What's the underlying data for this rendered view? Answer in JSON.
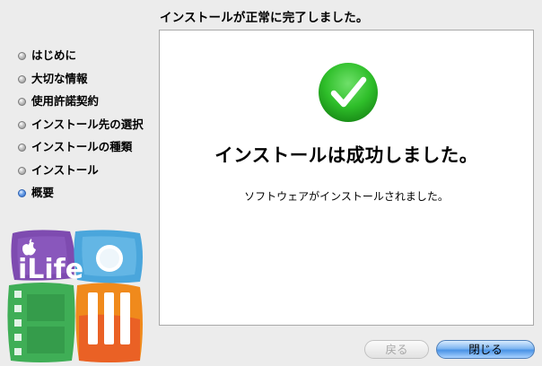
{
  "header": {
    "title": "インストールが正常に完了しました。"
  },
  "sidebar": {
    "steps": [
      {
        "label": "はじめに",
        "state": "done"
      },
      {
        "label": "大切な情報",
        "state": "done"
      },
      {
        "label": "使用許諾契約",
        "state": "done"
      },
      {
        "label": "インストール先の選択",
        "state": "done"
      },
      {
        "label": "インストールの種類",
        "state": "done"
      },
      {
        "label": "インストール",
        "state": "done"
      },
      {
        "label": "概要",
        "state": "active"
      }
    ],
    "logo_text": "iLife"
  },
  "main": {
    "success_title": "インストールは成功しました。",
    "success_message": "ソフトウェアがインストールされました。"
  },
  "footer": {
    "back_label": "戻る",
    "close_label": "閉じる"
  },
  "colors": {
    "success_green": "#2fbf2a",
    "active_bullet": "#2a63c4",
    "default_button": "#4a93e6"
  }
}
